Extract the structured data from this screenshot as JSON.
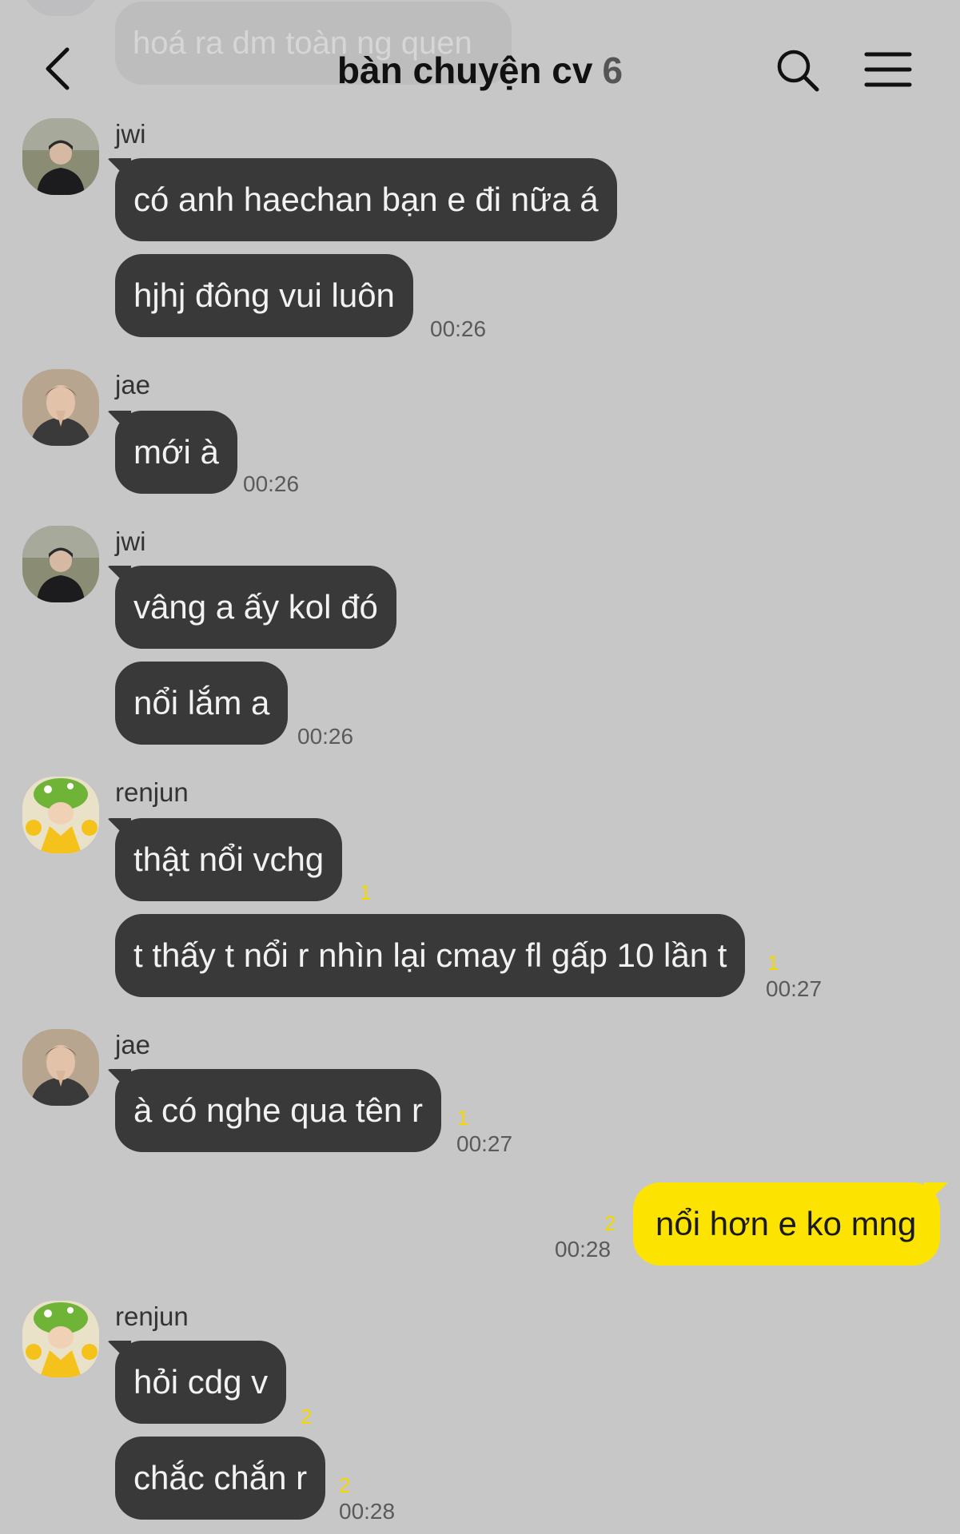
{
  "header": {
    "title": "bàn chuyện cv",
    "member_count": "6"
  },
  "faded_message": "hoá ra dm toàn ng quen",
  "messages": {
    "g1": {
      "sender": "jwi",
      "m1": "có anh haechan bạn e đi nữa á",
      "m2": "hjhj đông vui luôn",
      "time": "00:26"
    },
    "g2": {
      "sender": "jae",
      "m1": "mới à",
      "time": "00:26"
    },
    "g3": {
      "sender": "jwi",
      "m1": "vâng a ấy kol đó",
      "m2": "nổi lắm a",
      "time": "00:26"
    },
    "g4": {
      "sender": "renjun",
      "m1": "thật nổi vchg",
      "m1_unread": "1",
      "m2": "t thấy t nổi r nhìn lại cmay fl gấp 10 lần t",
      "m2_unread": "1",
      "time": "00:27"
    },
    "g5": {
      "sender": "jae",
      "m1": "à có nghe qua tên r",
      "unread": "1",
      "time": "00:27"
    },
    "mine": {
      "text": "nổi hơn e ko mng",
      "unread": "2",
      "time": "00:28"
    },
    "g6": {
      "sender": "renjun",
      "m1": "hỏi cdg v",
      "m1_unread": "2",
      "m2": "chắc chắn r",
      "m2_unread": "2",
      "time": "00:28"
    }
  },
  "colors": {
    "background": "#c7c7c8",
    "bubble_other": "#39393a",
    "bubble_mine": "#fde400",
    "unread": "#f3d800"
  }
}
